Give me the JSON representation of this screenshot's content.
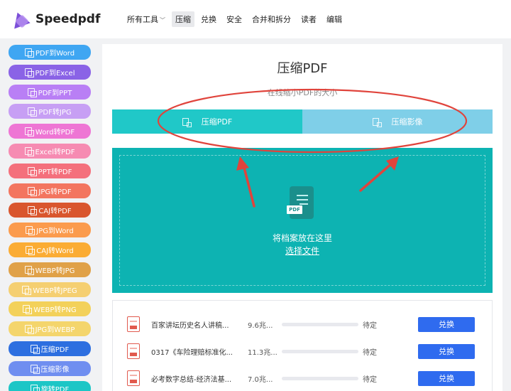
{
  "header": {
    "brand": "Speedpdf",
    "nav": [
      {
        "label": "所有工具",
        "has_caret": true,
        "active": false
      },
      {
        "label": "压缩",
        "active": true
      },
      {
        "label": "兑换",
        "active": false
      },
      {
        "label": "安全",
        "active": false
      },
      {
        "label": "合并和拆分",
        "active": false
      },
      {
        "label": "读者",
        "active": false
      },
      {
        "label": "编辑",
        "active": false
      }
    ]
  },
  "sidebar": {
    "items": [
      {
        "label": "PDF到Word",
        "color": "#3fa6f2"
      },
      {
        "label": "PDF到Excel",
        "color": "#8a63e6"
      },
      {
        "label": "PDF到PPT",
        "color": "#b97ff5"
      },
      {
        "label": "PDF转JPG",
        "color": "#c79ff4"
      },
      {
        "label": "Word转PDF",
        "color": "#ee76d4"
      },
      {
        "label": "Excel转PDF",
        "color": "#f68bb2"
      },
      {
        "label": "PPT转PDF",
        "color": "#f4707c"
      },
      {
        "label": "JPG转PDF",
        "color": "#f3755f"
      },
      {
        "label": "CAJ转PDF",
        "color": "#d9562e"
      },
      {
        "label": "JPG到Word",
        "color": "#fb9b4d"
      },
      {
        "label": "CAJ转Word",
        "color": "#fbac34"
      },
      {
        "label": "WEBP转JPG",
        "color": "#e0a148"
      },
      {
        "label": "WEBP转JPEG",
        "color": "#f5cf71"
      },
      {
        "label": "WEBP转PNG",
        "color": "#f3d15a"
      },
      {
        "label": "JPG到WEBP",
        "color": "#f4d56c"
      },
      {
        "label": "压缩PDF",
        "color": "#2d6fe0"
      },
      {
        "label": "压缩影像",
        "color": "#6f8ef0"
      },
      {
        "label": "旋转PDF",
        "color": "#1cc6c6"
      }
    ]
  },
  "main": {
    "title": "压缩PDF",
    "subtitle": "在线缩小PDF的大小",
    "tabs": [
      {
        "label": "压缩PDF",
        "active": true
      },
      {
        "label": "压缩影像",
        "active": false
      }
    ],
    "drop_icon_label": "PDF",
    "drop_text": "将档案放在这里",
    "drop_link": "选择文件"
  },
  "files": [
    {
      "name": "百家讲坛历史名人讲稿...",
      "size": "9.6兆...",
      "progress": 0,
      "status": "待定",
      "action": "兑换"
    },
    {
      "name": "0317《车险理赔标准化...",
      "size": "11.3兆...",
      "progress": 0,
      "status": "待定",
      "action": "兑换"
    },
    {
      "name": "必考数字总结-经济法基...",
      "size": "7.0兆...",
      "progress": 0,
      "status": "待定",
      "action": "兑换"
    }
  ],
  "colors": {
    "tab_active": "#20c8c8",
    "tab_inactive": "#7fcfe8",
    "dropzone": "#0db3b2",
    "action_button": "#2f6bef",
    "annotation": "#e0443c"
  }
}
